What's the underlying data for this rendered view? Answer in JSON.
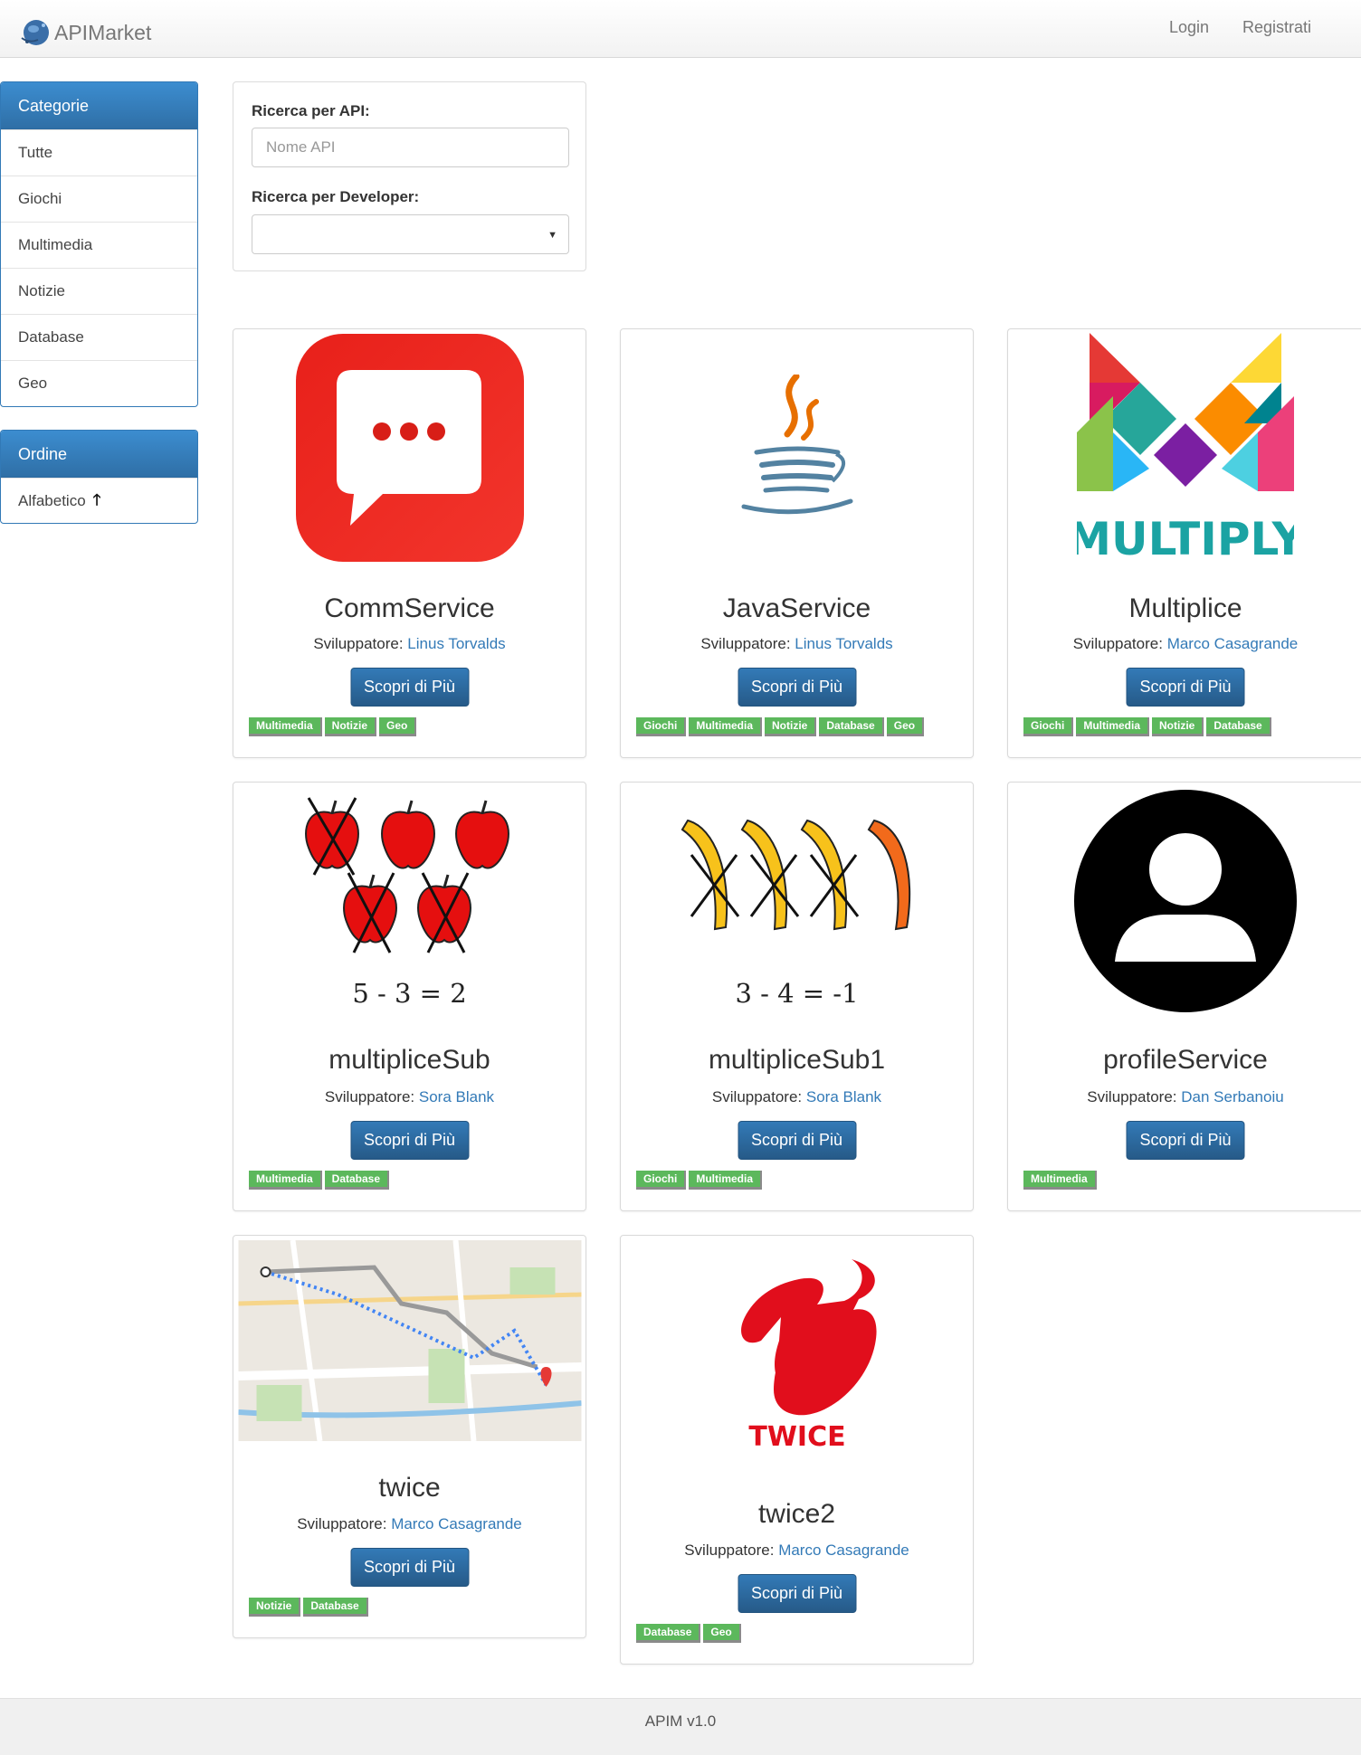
{
  "navbar": {
    "brand": "APIMarket",
    "login": "Login",
    "register": "Registrati"
  },
  "sidebar": {
    "categories": {
      "title": "Categorie",
      "items": [
        "Tutte",
        "Giochi",
        "Multimedia",
        "Notizie",
        "Database",
        "Geo"
      ]
    },
    "order": {
      "title": "Ordine",
      "item": "Alfabetico",
      "icon": "arrow-up-icon"
    }
  },
  "search": {
    "api_label": "Ricerca per API:",
    "api_placeholder": "Nome API",
    "api_value": "",
    "dev_label": "Ricerca per Developer:",
    "dev_value": ""
  },
  "card_common": {
    "dev_prefix": "Sviluppatore:",
    "button_label": "Scopri di Più"
  },
  "cards": [
    {
      "title": "CommService",
      "developer": "Linus Torvalds",
      "tags": [
        "Multimedia",
        "Notizie",
        "Geo"
      ],
      "image": "chat-bubble-icon"
    },
    {
      "title": "JavaService",
      "developer": "Linus Torvalds",
      "tags": [
        "Giochi",
        "Multimedia",
        "Notizie",
        "Database",
        "Geo"
      ],
      "image": "java-logo-icon"
    },
    {
      "title": "Multiplice",
      "developer": "Marco Casagrande",
      "tags": [
        "Giochi",
        "Multimedia",
        "Notizie",
        "Database"
      ],
      "image": "multiply-logo",
      "image_text": "MULTIPLY"
    },
    {
      "title": "multipliceSub",
      "developer": "Sora Blank",
      "tags": [
        "Multimedia",
        "Database"
      ],
      "image": "apples-subtraction",
      "image_text": "5 - 3 = 2"
    },
    {
      "title": "multipliceSub1",
      "developer": "Sora Blank",
      "tags": [
        "Giochi",
        "Multimedia"
      ],
      "image": "bananas-subtraction",
      "image_text": "3 - 4 = -1"
    },
    {
      "title": "profileService",
      "developer": "Dan Serbanoiu",
      "tags": [
        "Multimedia"
      ],
      "image": "user-avatar-icon"
    },
    {
      "title": "twice",
      "developer": "Marco Casagrande",
      "tags": [
        "Notizie",
        "Database"
      ],
      "image": "route-map"
    },
    {
      "title": "twice2",
      "developer": "Marco Casagrande",
      "tags": [
        "Database",
        "Geo"
      ],
      "image": "twice-logo",
      "image_text": "TWICE"
    }
  ],
  "footer": "APIM v1.0",
  "colors": {
    "primary": "#337ab7",
    "tag": "#5cb85c",
    "link": "#337ab7"
  }
}
